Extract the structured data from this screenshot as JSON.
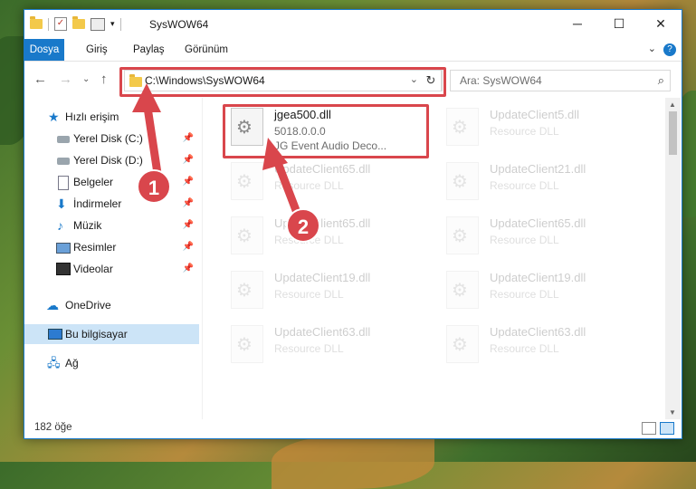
{
  "window": {
    "title": "SysWOW64",
    "controls": {
      "minimize": "─",
      "maximize": "☐",
      "close": "✕"
    }
  },
  "ribbon": {
    "tabs": [
      "Dosya",
      "Giriş",
      "Paylaş",
      "Görünüm"
    ],
    "help": "?"
  },
  "nav": {
    "address": "C:\\Windows\\SysWOW64",
    "search_placeholder": "Ara: SysWOW64"
  },
  "sidebar": {
    "quick_access": "Hızlı erişim",
    "pinned": [
      "Yerel Disk (C:)",
      "Yerel Disk (D:)",
      "Belgeler",
      "İndirmeler",
      "Müzik",
      "Resimler",
      "Videolar"
    ],
    "onedrive": "OneDrive",
    "this_pc": "Bu bilgisayar",
    "network": "Ağ"
  },
  "files": [
    {
      "name": "jgea500.dll",
      "line1": "5018.0.0.0",
      "line2": "JG Event Audio Deco..."
    },
    {
      "name": "UpdateClient5.dll",
      "line1": "Resource DLL"
    },
    {
      "name": "UpdateClient65.dll",
      "line1": "Resource DLL"
    },
    {
      "name": "UpdateClient21.dll",
      "line1": "Resource DLL"
    },
    {
      "name": "UpdateClient65.dll",
      "line1": "Resource DLL"
    },
    {
      "name": "UpdateClient65.dll",
      "line1": "Resource DLL"
    },
    {
      "name": "UpdateClient19.dll",
      "line1": "Resource DLL"
    },
    {
      "name": "UpdateClient19.dll",
      "line1": "Resource DLL"
    },
    {
      "name": "UpdateClient63.dll",
      "line1": "Resource DLL"
    },
    {
      "name": "UpdateClient63.dll",
      "line1": "Resource DLL"
    }
  ],
  "status": {
    "count": "182 öğe"
  },
  "annotations": {
    "step1": "1",
    "step2": "2"
  },
  "colors": {
    "accent": "#1979ca",
    "highlight": "#d9464c",
    "selected": "#cce4f7"
  }
}
